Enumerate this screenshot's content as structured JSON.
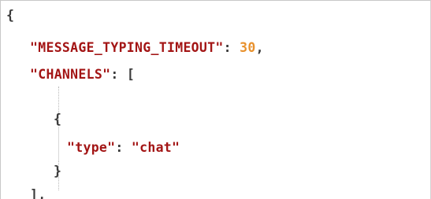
{
  "editor": {
    "lines": [
      {
        "open_brace": "{"
      },
      {
        "key": "\"MESSAGE_TYPING_TIMEOUT\"",
        "colon": ": ",
        "value": "30",
        "comma": ","
      },
      {
        "key": "\"CHANNELS\"",
        "colon": ": ",
        "open_bracket": "["
      },
      {
        "open_brace": "{"
      },
      {
        "key": "\"type\"",
        "colon": ": ",
        "value": "\"chat\""
      },
      {
        "close_brace": "}"
      },
      {
        "close_bracket": "],"
      }
    ]
  },
  "colors": {
    "key": "#a31515",
    "string": "#a31515",
    "number": "#e8912d",
    "punctuation": "#3b3b3b"
  }
}
